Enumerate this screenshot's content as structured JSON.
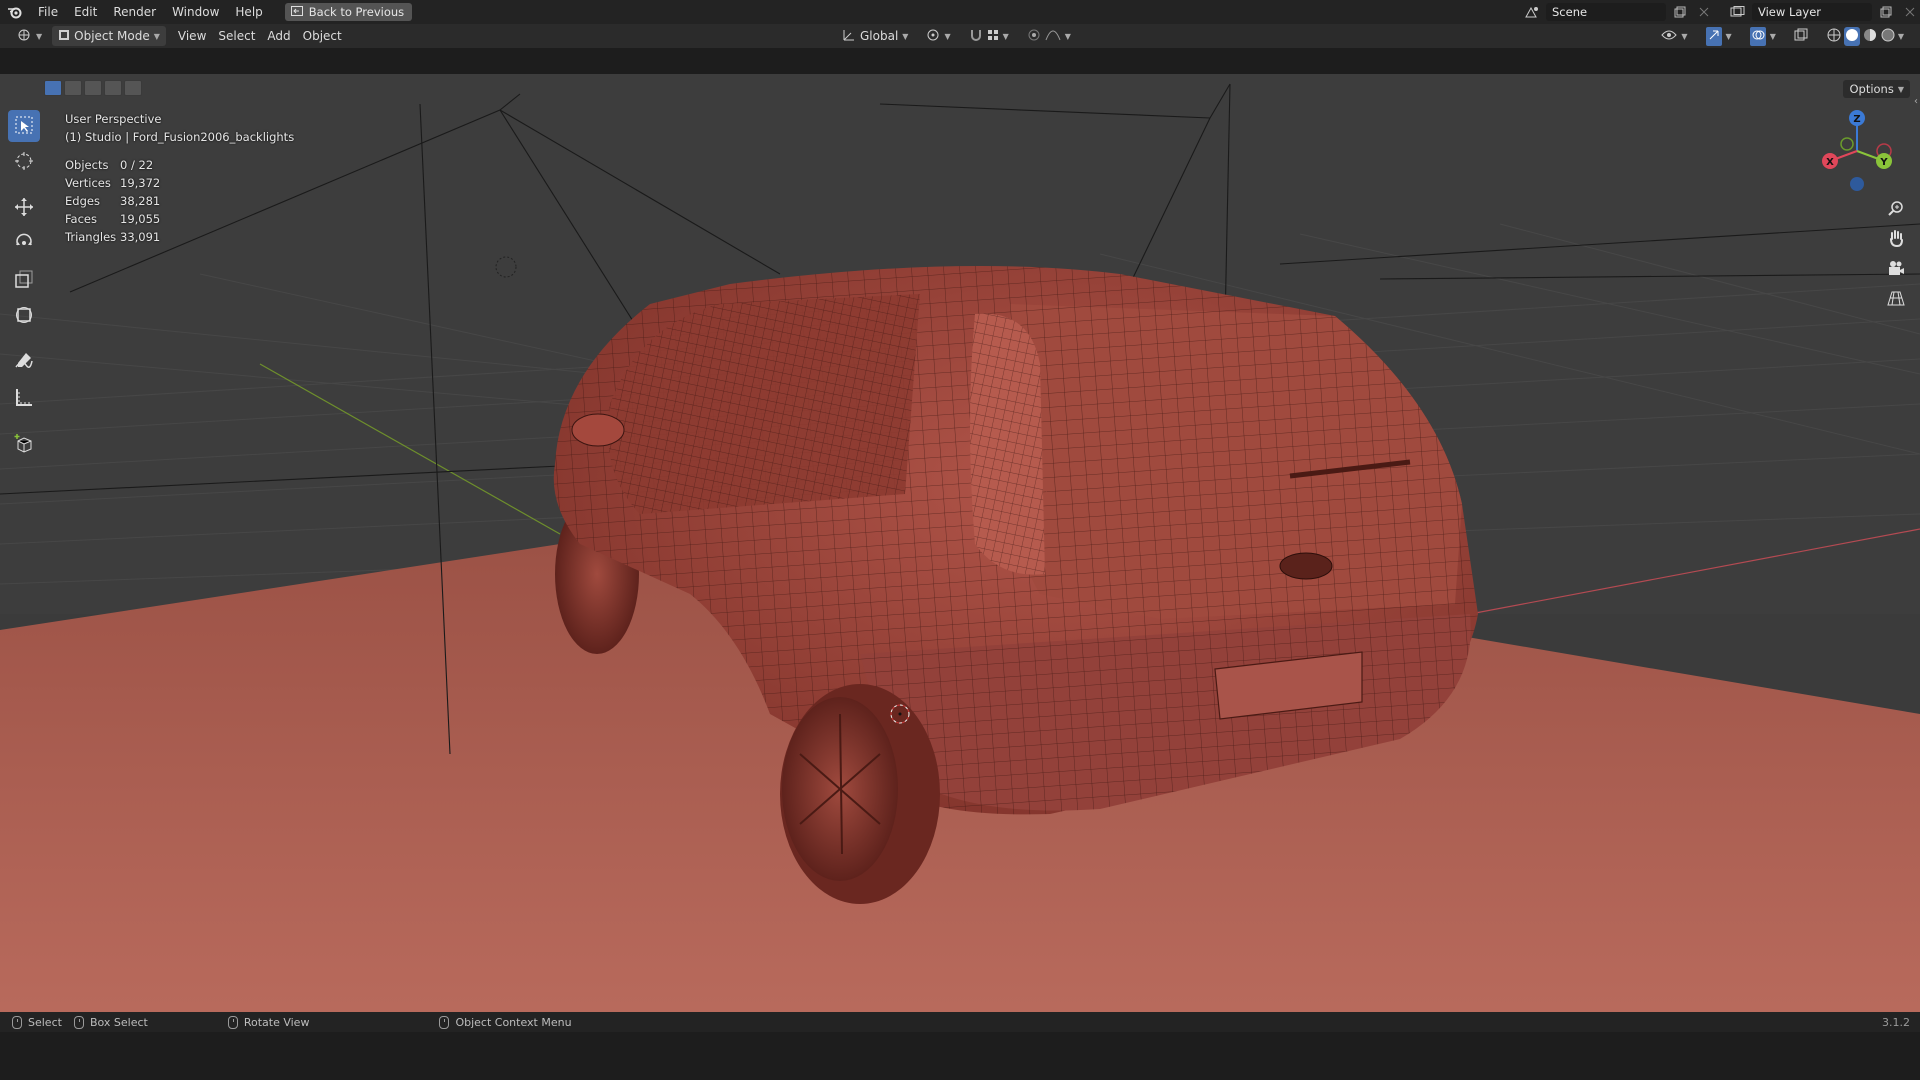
{
  "topbar": {
    "menus": [
      "File",
      "Edit",
      "Render",
      "Window",
      "Help"
    ],
    "back_button": "Back to Previous",
    "scene_name": "Scene",
    "view_layer": "View Layer"
  },
  "viewport_header": {
    "mode": "Object Mode",
    "menus": [
      "View",
      "Select",
      "Add",
      "Object"
    ],
    "transform_orientation": "Global",
    "options_label": "Options"
  },
  "overlay": {
    "perspective": "User Perspective",
    "collection_object": "(1) Studio | Ford_Fusion2006_backlights",
    "stats": [
      {
        "label": "Objects",
        "value": "0 / 22"
      },
      {
        "label": "Vertices",
        "value": "19,372"
      },
      {
        "label": "Edges",
        "value": "38,281"
      },
      {
        "label": "Faces",
        "value": "19,055"
      },
      {
        "label": "Triangles",
        "value": "33,091"
      }
    ]
  },
  "gizmo": {
    "x": "X",
    "y": "Y",
    "z": "Z"
  },
  "statusbar": {
    "items": [
      "Select",
      "Box Select",
      "Rotate View",
      "Object Context Menu"
    ],
    "version": "3.1.2"
  },
  "colors": {
    "accent": "#4772b3",
    "floor": "#a85a4c",
    "car": "#a6483c",
    "axis_x": "#e0475a",
    "axis_y": "#8ac43a",
    "axis_z": "#3b7ad6"
  }
}
